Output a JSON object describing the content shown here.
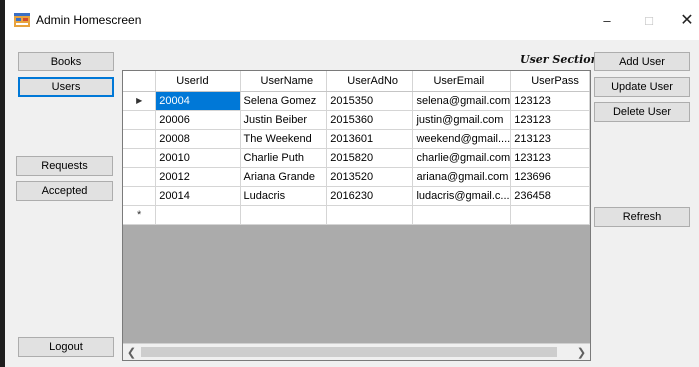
{
  "window": {
    "title": "Admin Homescreen",
    "icon": "app-form-icon",
    "controls": {
      "minimize": "–",
      "maximize": "□",
      "close": "✕"
    }
  },
  "nav": {
    "books": "Books",
    "users": "Users",
    "requests": "Requests",
    "accepted": "Accepted",
    "logout": "Logout"
  },
  "section_label": "User Section",
  "actions": {
    "add_user": "Add User",
    "update_user": "Update User",
    "delete_user": "Delete User",
    "refresh": "Refresh"
  },
  "table": {
    "columns": [
      "UserId",
      "UserName",
      "UserAdNo",
      "UserEmail",
      "UserPass"
    ],
    "rows": [
      [
        "20004",
        "Selena Gomez",
        "2015350",
        "selena@gmail.com",
        "123123"
      ],
      [
        "20006",
        "Justin Beiber",
        "2015360",
        "justin@gmail.com",
        "123123"
      ],
      [
        "20008",
        "The Weekend",
        "2013601",
        "weekend@gmail....",
        "213123"
      ],
      [
        "20010",
        "Charlie Puth",
        "2015820",
        "charlie@gmail.com",
        "123123"
      ],
      [
        "20012",
        "Ariana Grande",
        "2013520",
        "ariana@gmail.com",
        "123696"
      ],
      [
        "20014",
        "Ludacris",
        "2016230",
        "ludacris@gmail.c...",
        "236458"
      ]
    ],
    "current_row_marker": "▶",
    "new_row_marker": "*"
  },
  "colors": {
    "selection": "#0078d7",
    "form_background": "#f0f0f0",
    "grid_background": "#ababab"
  }
}
